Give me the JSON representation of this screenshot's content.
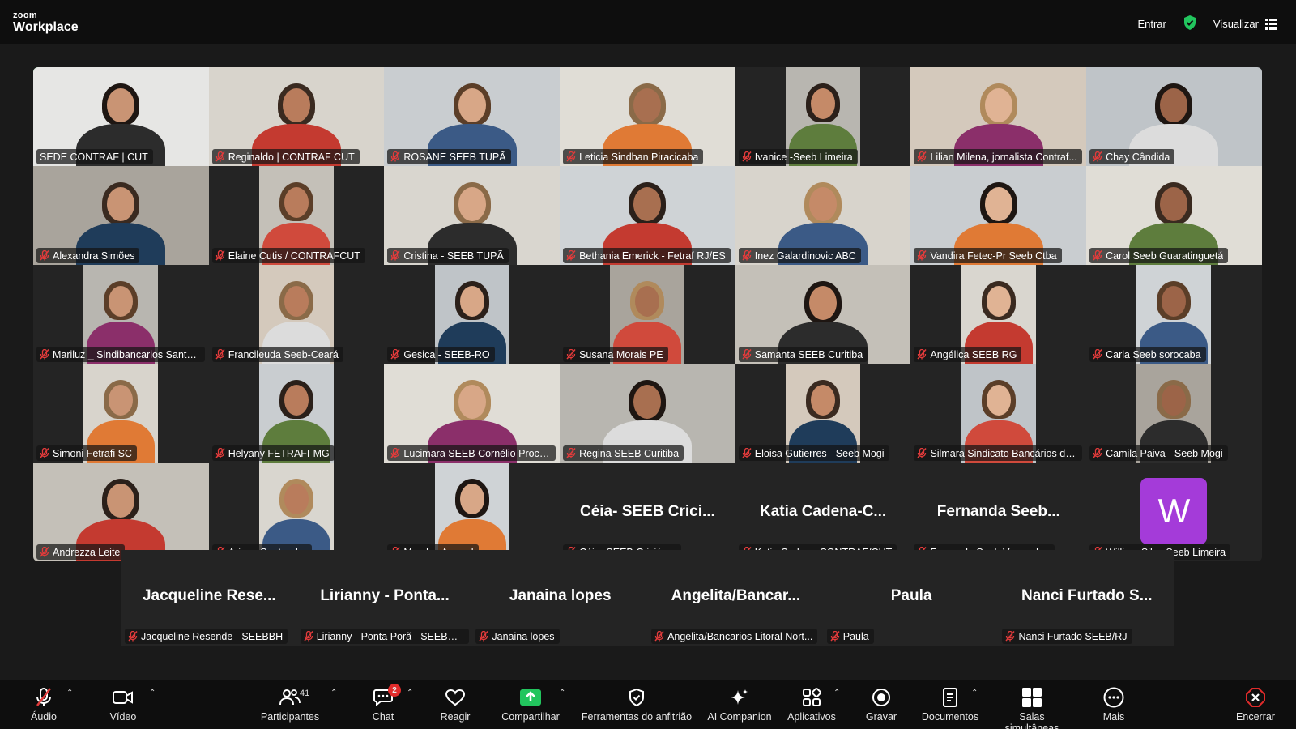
{
  "app": {
    "logo_top": "zoom",
    "logo_bottom": "Workplace",
    "join_label": "Entrar",
    "view_label": "Visualizar"
  },
  "colors": {
    "active_speaker_border": "#22c55e",
    "muted_mic": "#e23b3b",
    "avatar_w": "#a43bd9",
    "share_button": "#22c55e",
    "end_button": "#e02b2b"
  },
  "participants_grid": [
    {
      "label": "SEDE CONTRAF | CUT",
      "video": true,
      "active": true,
      "muted": false
    },
    {
      "label": "Reginaldo | CONTRAF CUT",
      "video": true,
      "muted": true
    },
    {
      "label": "ROSANE SEEB TUPÃ",
      "video": true,
      "muted": true
    },
    {
      "label": "Leticia Sindban Piracicaba",
      "video": true,
      "muted": true
    },
    {
      "label": "Ivanice -Seeb Limeira",
      "video": true,
      "muted": true
    },
    {
      "label": "Lilian Milena, jornalista Contraf...",
      "video": true,
      "muted": true
    },
    {
      "label": "Chay Cândida",
      "video": true,
      "muted": true
    },
    {
      "label": "Alexandra Simões",
      "video": true,
      "muted": true
    },
    {
      "label": "Elaine Cutis / CONTRAFCUT",
      "video": true,
      "muted": true
    },
    {
      "label": "Cristina - SEEB TUPÃ",
      "video": true,
      "muted": true
    },
    {
      "label": "Bethania Emerick - Fetraf RJ/ES",
      "video": true,
      "muted": true
    },
    {
      "label": "Inez Galardinovic ABC",
      "video": true,
      "muted": true
    },
    {
      "label": "Vandira Fetec-Pr Seeb Ctba",
      "video": true,
      "muted": true
    },
    {
      "label": "Carol Seeb Guaratinguetá",
      "video": true,
      "muted": true
    },
    {
      "label": "Mariluz _ Sindibancarios Santa ...",
      "video": true,
      "muted": true
    },
    {
      "label": "Francileuda Seeb-Ceará",
      "video": true,
      "muted": true
    },
    {
      "label": "Gesica - SEEB-RO",
      "video": true,
      "muted": true
    },
    {
      "label": "Susana Morais PE",
      "video": true,
      "muted": true
    },
    {
      "label": "Samanta SEEB Curitiba",
      "video": true,
      "muted": true
    },
    {
      "label": "Angélica  SEEB RG",
      "video": true,
      "muted": true
    },
    {
      "label": "Carla Seeb sorocaba",
      "video": true,
      "muted": true
    },
    {
      "label": "Simoni Fetrafi SC",
      "video": true,
      "muted": true
    },
    {
      "label": "Helyany FETRAFI-MG",
      "video": true,
      "muted": true
    },
    {
      "label": "Lucimara SEEB Cornélio Procóp...",
      "video": true,
      "muted": true
    },
    {
      "label": "Regina SEEB Curitiba",
      "video": true,
      "muted": true
    },
    {
      "label": "Eloisa Gutierres - Seeb Mogi",
      "video": true,
      "muted": true
    },
    {
      "label": "Silmara Sindicato Bancários de ...",
      "video": true,
      "muted": true
    },
    {
      "label": "Camila Paiva - Seeb Mogi",
      "video": true,
      "muted": true
    },
    {
      "label": "Andrezza Leite",
      "video": true,
      "muted": true
    },
    {
      "label": "Ariane Santander",
      "video": true,
      "muted": true
    },
    {
      "label": "Marcley Amaral",
      "video": true,
      "muted": true
    },
    {
      "label": "Céia- SEEB Criciúma",
      "video": false,
      "display_name": "Céia-  SEEB Crici...",
      "muted": true
    },
    {
      "label": "Katia Cadena-CONTRAF/CUT",
      "video": false,
      "display_name": "Katia  Cadena-C...",
      "muted": true
    },
    {
      "label": "Fernanda Seeb Venceslau",
      "video": false,
      "display_name": "Fernanda  Seeb...",
      "muted": true
    },
    {
      "label": "William Silva Seeb Limeira",
      "video": false,
      "avatar_letter": "W",
      "muted": true
    }
  ],
  "participants_row6": [
    {
      "label": "Jacqueline Resende - SEEBBH",
      "display_name": "Jacqueline  Rese...",
      "muted": true
    },
    {
      "label": "Lirianny - Ponta Porã - SEEBPP ...",
      "display_name": "Lirianny  -  Ponta...",
      "muted": true
    },
    {
      "label": "Janaina lopes",
      "display_name": "Janaina  lopes",
      "muted": true
    },
    {
      "label": "Angelita/Bancarios Litoral Nort...",
      "display_name": "Angelita/Bancar...",
      "muted": true
    },
    {
      "label": "Paula",
      "display_name": "Paula",
      "muted": true
    },
    {
      "label": "Nanci Furtado SEEB/RJ",
      "display_name": "Nanci  Furtado  S...",
      "muted": true
    }
  ],
  "toolbar": {
    "audio": "Áudio",
    "video": "Vídeo",
    "participants": "Participantes",
    "participants_count": "41",
    "chat": "Chat",
    "chat_badge": "2",
    "react": "Reagir",
    "share": "Compartilhar",
    "host_tools": "Ferramentas do anfitrião",
    "ai_companion": "AI Companion",
    "apps": "Aplicativos",
    "record": "Gravar",
    "docs": "Documentos",
    "breakout": "Salas simultâneas",
    "more": "Mais",
    "end": "Encerrar"
  }
}
